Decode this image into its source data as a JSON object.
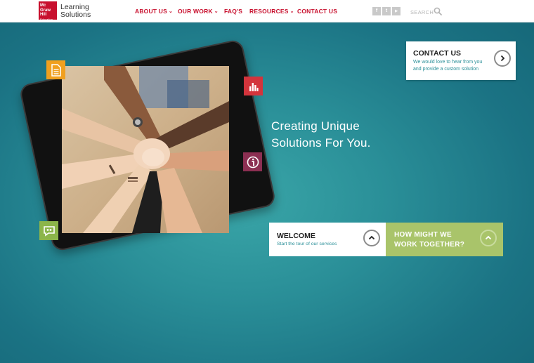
{
  "brand": {
    "logo_lines": [
      "Mc",
      "Graw",
      "Hill"
    ],
    "logo_tiny": "Education",
    "name_lines": [
      "Learning",
      "Solutions"
    ],
    "accent_color": "#c8102e"
  },
  "nav": {
    "items": [
      {
        "label": "ABOUT US",
        "has_dropdown": true
      },
      {
        "label": "OUR WORK",
        "has_dropdown": true
      },
      {
        "label": "FAQ'S",
        "has_dropdown": false
      },
      {
        "label": "RESOURCES",
        "has_dropdown": true
      },
      {
        "label": "CONTACT US",
        "has_dropdown": false
      }
    ],
    "dropdown_glyph": "⌄"
  },
  "social": [
    {
      "icon": "facebook-icon",
      "glyph": "f"
    },
    {
      "icon": "twitter-icon",
      "glyph": "t"
    },
    {
      "icon": "youtube-icon",
      "glyph": "▶"
    }
  ],
  "search": {
    "label": "SEARCH",
    "icon": "search-icon"
  },
  "hero": {
    "tagline_lines": [
      "Creating Unique",
      "Solutions For You."
    ],
    "badges": [
      {
        "icon": "document-icon",
        "color": "#f0a01f"
      },
      {
        "icon": "bar-chart-icon",
        "color": "#d3343c"
      },
      {
        "icon": "info-icon",
        "color": "#8c2f52"
      },
      {
        "icon": "quote-bubble-icon",
        "color": "#8cb54a"
      }
    ]
  },
  "contact_card": {
    "title": "CONTACT US",
    "sub_lines": [
      "We would love to hear from you",
      "and provide a custom solution"
    ],
    "button_icon": "chevron-right-icon"
  },
  "welcome_card": {
    "title": "WELCOME",
    "subtitle": "Start the tour of our services",
    "button_icon": "chevron-up-icon"
  },
  "work_card": {
    "title_lines": [
      "HOW MIGHT WE",
      "WORK TOGETHER?"
    ],
    "button_icon": "chevron-up-icon",
    "color": "#a9c46a"
  }
}
